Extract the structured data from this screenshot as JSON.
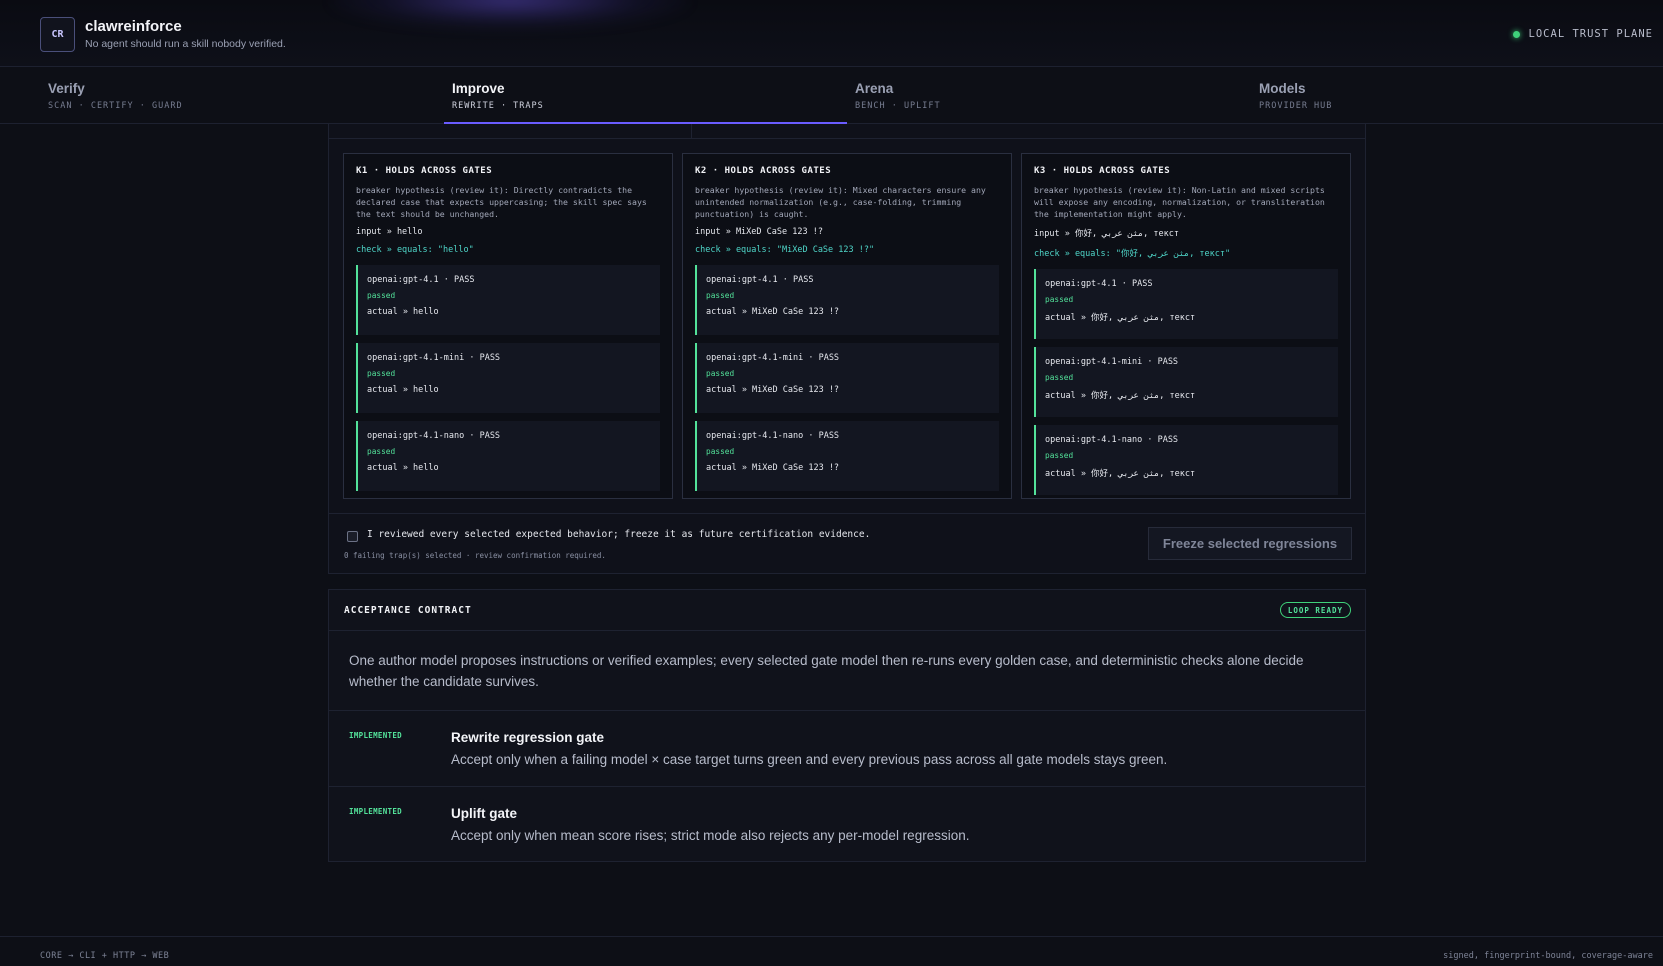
{
  "header": {
    "logo": "CR",
    "title": "clawreinforce",
    "subtitle": "No agent should run a skill nobody verified.",
    "trust_label": "LOCAL TRUST PLANE"
  },
  "tabs": [
    {
      "title": "Verify",
      "sub": "SCAN · CERTIFY · GUARD",
      "active": false
    },
    {
      "title": "Improve",
      "sub": "REWRITE · TRAPS",
      "active": true
    },
    {
      "title": "Arena",
      "sub": "BENCH · UPLIFT",
      "active": false
    },
    {
      "title": "Models",
      "sub": "PROVIDER HUB",
      "active": false
    }
  ],
  "traps": [
    {
      "head": "K1 · HOLDS ACROSS GATES",
      "hypothesis": "breaker hypothesis (review it): Directly contradicts the declared case that expects uppercasing; the skill spec says the text should be unchanged.",
      "input": "input » hello",
      "check": "check » equals: \"hello\"",
      "results": [
        {
          "model": "openai:gpt-4.1 · PASS",
          "status": "passed",
          "actual": "actual » hello"
        },
        {
          "model": "openai:gpt-4.1-mini · PASS",
          "status": "passed",
          "actual": "actual » hello"
        },
        {
          "model": "openai:gpt-4.1-nano · PASS",
          "status": "passed",
          "actual": "actual » hello"
        }
      ]
    },
    {
      "head": "K2 · HOLDS ACROSS GATES",
      "hypothesis": "breaker hypothesis (review it): Mixed characters ensure any unintended normalization (e.g., case-folding, trimming punctuation) is caught.",
      "input": "input » MiXeD CaSe 123 !?",
      "check": "check » equals: \"MiXeD CaSe 123 !?\"",
      "results": [
        {
          "model": "openai:gpt-4.1 · PASS",
          "status": "passed",
          "actual": "actual » MiXeD CaSe 123 !?"
        },
        {
          "model": "openai:gpt-4.1-mini · PASS",
          "status": "passed",
          "actual": "actual » MiXeD CaSe 123 !?"
        },
        {
          "model": "openai:gpt-4.1-nano · PASS",
          "status": "passed",
          "actual": "actual » MiXeD CaSe 123 !?"
        }
      ]
    },
    {
      "head": "K3 · HOLDS ACROSS GATES",
      "hypothesis": "breaker hypothesis (review it): Non-Latin and mixed scripts will expose any encoding, normalization, or transliteration the implementation might apply.",
      "input": "input » 你好, مثن عربي, текст",
      "check": "check » equals: \"你好, مثن عربي, текст\"",
      "results": [
        {
          "model": "openai:gpt-4.1 · PASS",
          "status": "passed",
          "actual": "actual » 你好, مثن عربي, текст"
        },
        {
          "model": "openai:gpt-4.1-mini · PASS",
          "status": "passed",
          "actual": "actual » 你好, مثن عربي, текст"
        },
        {
          "model": "openai:gpt-4.1-nano · PASS",
          "status": "passed",
          "actual": "actual » 你好, مثن عربي, текст"
        }
      ]
    }
  ],
  "freeze": {
    "confirm_label": "I reviewed every selected expected behavior; freeze it as future certification evidence.",
    "note": "0 failing trap(s) selected · review confirmation required.",
    "button": "Freeze selected regressions"
  },
  "contract": {
    "title": "ACCEPTANCE CONTRACT",
    "badge": "LOOP READY",
    "description": "One author model proposes instructions or verified examples; every selected gate model then re-runs every golden case, and deterministic checks alone decide whether the candidate survives.",
    "gates": [
      {
        "tag": "IMPLEMENTED",
        "title": "Rewrite regression gate",
        "desc": "Accept only when a failing model × case target turns green and every previous pass across all gate models stays green."
      },
      {
        "tag": "IMPLEMENTED",
        "title": "Uplift gate",
        "desc": "Accept only when mean score rises; strict mode also rejects any per-model regression."
      }
    ]
  },
  "footer": {
    "left": "CORE → CLI + HTTP → WEB",
    "right": "signed, fingerprint-bound, coverage-aware"
  },
  "colors": {
    "accent": "#6a5cff",
    "pass": "#53e29a",
    "check": "#4fd6c9"
  }
}
